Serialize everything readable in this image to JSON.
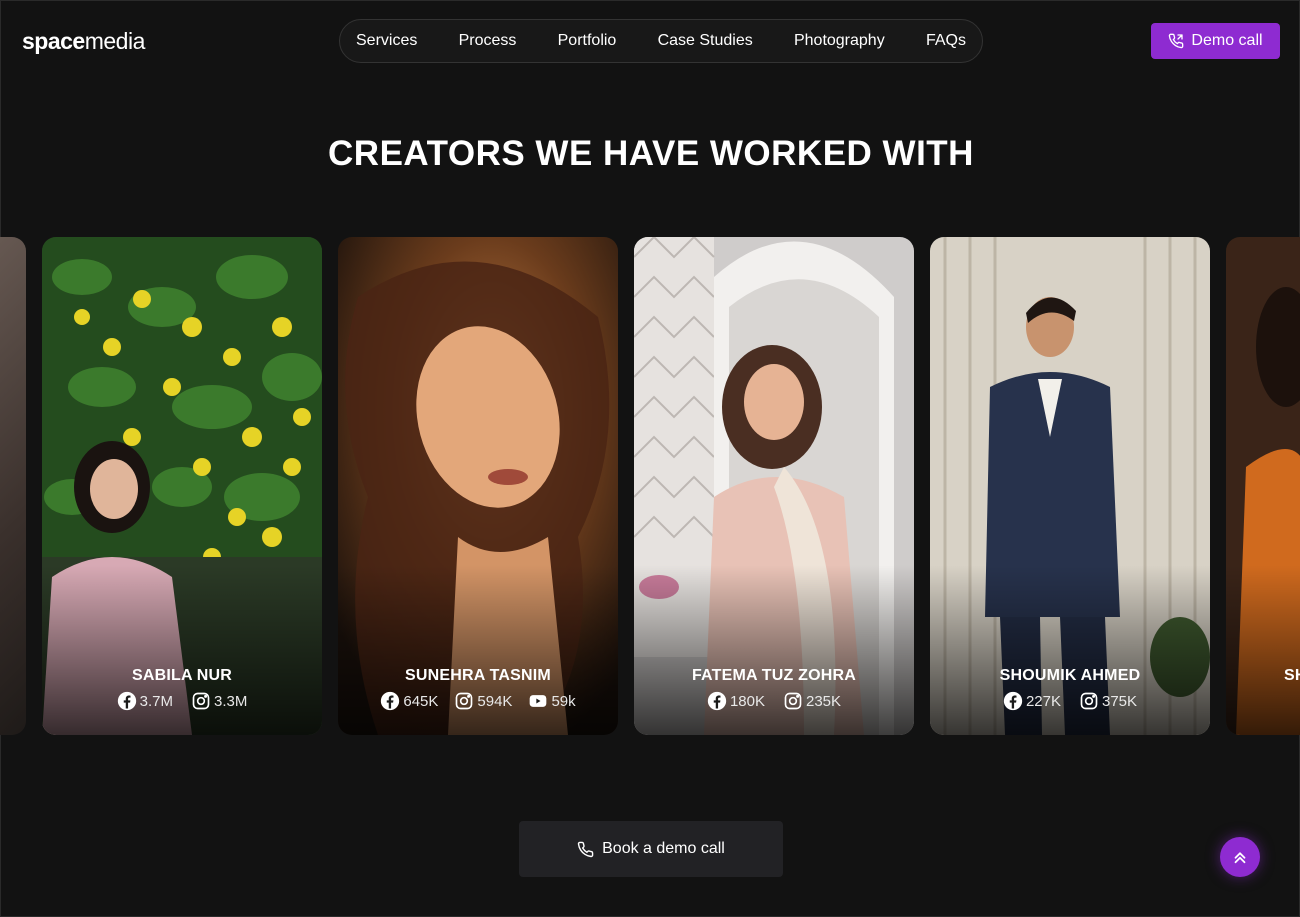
{
  "brand": {
    "logo_bold": "space",
    "logo_light": "media"
  },
  "nav": {
    "items": [
      "Services",
      "Process",
      "Portfolio",
      "Case Studies",
      "Photography",
      "FAQs"
    ]
  },
  "header": {
    "demo_call_label": "Demo call"
  },
  "section": {
    "title": "CREATORS WE HAVE WORKED WITH"
  },
  "creators": [
    {
      "name": "SABILA NUR",
      "facebook": "3.7M",
      "instagram": "3.3M"
    },
    {
      "name": "SUNEHRA TASNIM",
      "facebook": "645K",
      "instagram": "594K",
      "youtube": "59k"
    },
    {
      "name": "FATEMA TUZ ZOHRA",
      "facebook": "180K",
      "instagram": "235K"
    },
    {
      "name": "SHOUMIK AHMED",
      "facebook": "227K",
      "instagram": "375K"
    },
    {
      "name": "SH"
    }
  ],
  "cta": {
    "book_label": "Book a demo call"
  },
  "colors": {
    "accent": "#8e2bd1",
    "background": "#121212"
  },
  "icons": [
    "phone-icon",
    "facebook-icon",
    "instagram-icon",
    "youtube-icon",
    "chevrons-up-icon"
  ]
}
